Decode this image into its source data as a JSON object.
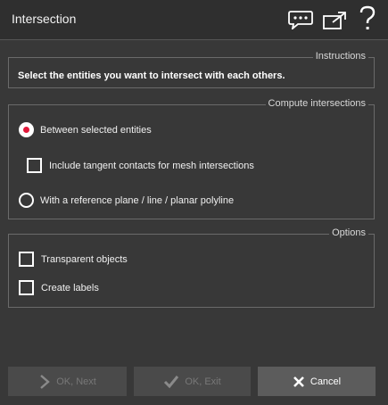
{
  "window": {
    "title": "Intersection",
    "icons": [
      "chat-bubble-icon",
      "popout-icon",
      "help-icon"
    ]
  },
  "instructions": {
    "legend": "Instructions",
    "text": "Select the entities you want to intersect with each others."
  },
  "compute": {
    "legend": "Compute intersections",
    "option_between": "Between selected entities",
    "option_between_selected": true,
    "include_tangent": "Include tangent contacts for mesh intersections",
    "include_tangent_checked": false,
    "option_reference": "With a reference plane / line / planar polyline",
    "option_reference_selected": false
  },
  "options": {
    "legend": "Options",
    "transparent_objects": "Transparent objects",
    "transparent_checked": false,
    "create_labels": "Create labels",
    "create_labels_checked": false
  },
  "buttons": {
    "next": "OK, Next",
    "exit": "OK, Exit",
    "cancel": "Cancel"
  },
  "colors": {
    "background": "#383838",
    "radio_accent": "#e2183a"
  }
}
